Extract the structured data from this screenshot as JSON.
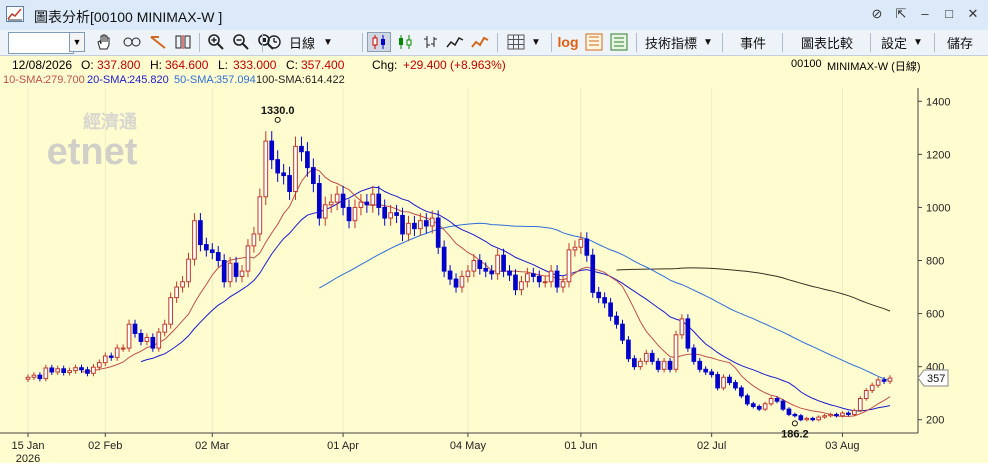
{
  "window": {
    "title": "圖表分析[00100 MINIMAX-W ]"
  },
  "toolbar": {
    "symbol_value": "",
    "period_label": "日線",
    "log_label": "log",
    "indicators_label": "技術指標",
    "events_label": "事件",
    "compare_label": "圖表比較",
    "settings_label": "設定",
    "save_label": "儲存"
  },
  "quote": {
    "date": "12/08/2026",
    "open_label": "O:",
    "open": "337.800",
    "high_label": "H:",
    "high": "364.600",
    "low_label": "L:",
    "low": "333.000",
    "close_label": "C:",
    "close": "357.400",
    "change_label": "Chg:",
    "change": "+29.400 (+8.963%)",
    "symbol_code": "00100",
    "symbol_name": "MINIMAX-W (日線)"
  },
  "sma": [
    {
      "label": "10-SMA:",
      "value": "279.700",
      "color": "#c0504d"
    },
    {
      "label": "20-SMA:",
      "value": "245.820",
      "color": "#1a1acc"
    },
    {
      "label": "50-SMA:",
      "value": "357.094",
      "color": "#2f6fd8"
    },
    {
      "label": "100-SMA:",
      "value": "614.422",
      "color": "#222222"
    }
  ],
  "watermark": {
    "cn": "經濟通",
    "en": "etnet"
  },
  "colors": {
    "up": "#c0392b",
    "down": "#0000cc",
    "sma10": "#c0504d",
    "sma20": "#1a1acc",
    "sma50": "#2f6fd8",
    "sma100": "#3a3020"
  },
  "chart_data": {
    "type": "candlestick",
    "ylim": [
      150,
      1450
    ],
    "yticks": [
      200,
      400,
      600,
      800,
      1000,
      1200,
      1400
    ],
    "xticks": [
      {
        "label": "15 Jan",
        "idx": 0
      },
      {
        "label": "02 Feb",
        "idx": 13
      },
      {
        "label": "02 Mar",
        "idx": 31
      },
      {
        "label": "01 Apr",
        "idx": 53
      },
      {
        "label": "04 May",
        "idx": 74
      },
      {
        "label": "01 Jun",
        "idx": 93
      },
      {
        "label": "02 Jul",
        "idx": 115
      },
      {
        "label": "03 Aug",
        "idx": 137
      }
    ],
    "year_label": "2026",
    "last_price_label": "357",
    "last_price": 357.4,
    "annotations": [
      {
        "text": "1330.0",
        "idx": 42,
        "value": 1330
      },
      {
        "text": "186.2",
        "idx": 129,
        "value": 186.2
      }
    ],
    "closes": [
      360,
      368,
      355,
      395,
      380,
      392,
      378,
      385,
      396,
      388,
      375,
      398,
      415,
      440,
      435,
      470,
      470,
      560,
      525,
      495,
      510,
      470,
      530,
      560,
      660,
      700,
      720,
      805,
      950,
      860,
      840,
      830,
      800,
      720,
      790,
      740,
      760,
      855,
      900,
      1040,
      1250,
      1180,
      1130,
      1120,
      1060,
      1230,
      1210,
      1150,
      1090,
      960,
      1010,
      1020,
      1050,
      1000,
      950,
      1000,
      1020,
      1010,
      1050,
      1000,
      960,
      980,
      970,
      900,
      940,
      920,
      950,
      930,
      960,
      850,
      760,
      730,
      700,
      740,
      760,
      800,
      770,
      760,
      750,
      820,
      760,
      745,
      690,
      720,
      750,
      740,
      720,
      720,
      760,
      700,
      720,
      840,
      850,
      880,
      820,
      680,
      660,
      640,
      590,
      560,
      500,
      430,
      400,
      420,
      450,
      420,
      390,
      420,
      390,
      520,
      580,
      470,
      420,
      390,
      380,
      370,
      320,
      360,
      340,
      320,
      290,
      260,
      250,
      240,
      260,
      280,
      270,
      240,
      220,
      215,
      200,
      205,
      200,
      210,
      215,
      220,
      215,
      225,
      220,
      235,
      280,
      310,
      330,
      350,
      345,
      357
    ]
  }
}
